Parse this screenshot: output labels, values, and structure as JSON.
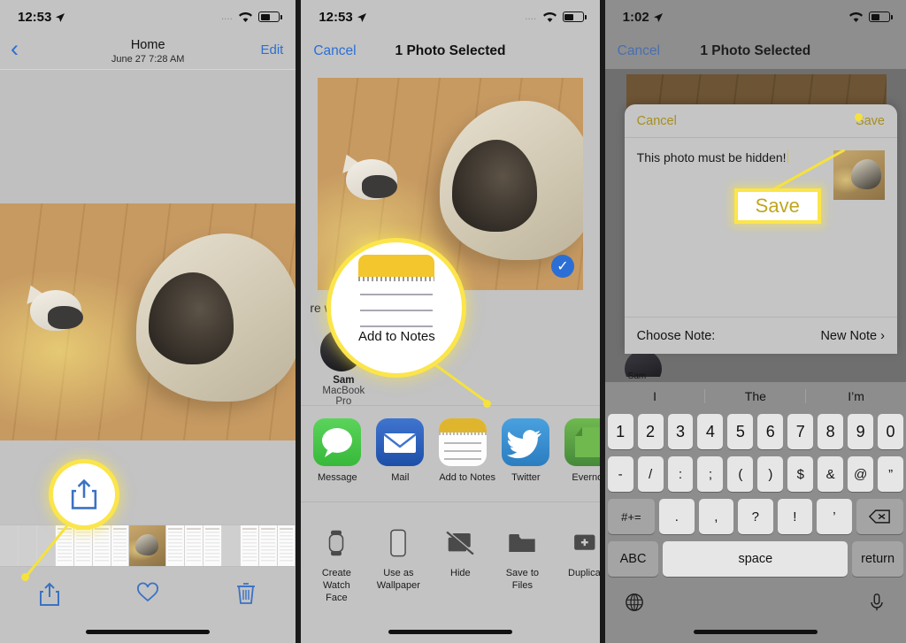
{
  "panel1": {
    "status": {
      "time": "12:53",
      "location_icon": "location-arrow-icon",
      "dots": "....",
      "wifi_icon": "wifi-icon",
      "battery_icon": "battery-icon"
    },
    "nav": {
      "back_icon": "chevron-left-icon",
      "title": "Home",
      "subtitle": "June 27  7:28 AM",
      "edit_label": "Edit"
    },
    "toolbar": {
      "share_icon": "share-icon",
      "favorite_icon": "heart-icon",
      "delete_icon": "trash-icon"
    },
    "callout": {
      "icon": "share-icon",
      "target": "share-button"
    }
  },
  "panel2": {
    "status": {
      "time": "12:53",
      "location_icon": "location-arrow-icon",
      "dots": "....",
      "wifi_icon": "wifi-icon",
      "battery_icon": "battery-icon"
    },
    "nav": {
      "cancel_label": "Cancel",
      "title": "1 Photo Selected"
    },
    "photo": {
      "selected_icon": "check-circle-icon"
    },
    "airdrop": {
      "label": "re with AirDrop",
      "person_name": "Sam",
      "person_device": "MacBook Pro"
    },
    "apps": [
      {
        "label": "Message",
        "icon": "message-icon"
      },
      {
        "label": "Mail",
        "icon": "mail-icon"
      },
      {
        "label": "Add to Notes",
        "icon": "notes-icon"
      },
      {
        "label": "Twitter",
        "icon": "twitter-icon"
      },
      {
        "label": "Evernot",
        "icon": "evernote-icon"
      }
    ],
    "actions": [
      {
        "label": "Create\nWatch Face",
        "line1": "Create",
        "line2": "Watch Face",
        "icon": "watch-icon"
      },
      {
        "label": "Use as Wallpaper",
        "line1": "Use as",
        "line2": "Wallpaper",
        "icon": "phone-icon"
      },
      {
        "label": "Hide",
        "line1": "Hide",
        "line2": "",
        "icon": "hide-slash-icon"
      },
      {
        "label": "Save to Files",
        "line1": "Save to Files",
        "line2": "",
        "icon": "folder-icon"
      },
      {
        "label": "Duplica",
        "line1": "Duplica",
        "line2": "",
        "icon": "duplicate-plus-icon"
      }
    ],
    "callout": {
      "label": "Add to Notes",
      "icon": "notes-icon",
      "target": "add-to-notes-app"
    }
  },
  "panel3": {
    "status": {
      "time": "1:02",
      "location_icon": "location-arrow-icon",
      "dots": "....",
      "wifi_icon": "wifi-icon",
      "battery_icon": "battery-icon"
    },
    "nav": {
      "cancel_label": "Cancel",
      "title": "1 Photo Selected"
    },
    "sheet": {
      "cancel_label": "Cancel",
      "save_label": "Save",
      "note_text": "This photo must be hidden!",
      "choose_note_label": "Choose Note:",
      "choose_note_value": "New Note",
      "chevron_icon": "chevron-right-icon"
    },
    "callout": {
      "label": "Save",
      "target": "save-button"
    },
    "background": {
      "person_name": "Sam"
    },
    "keyboard": {
      "predictions": [
        "I",
        "The",
        "I’m"
      ],
      "row_numbers": [
        "1",
        "2",
        "3",
        "4",
        "5",
        "6",
        "7",
        "8",
        "9",
        "0"
      ],
      "row_symbols": [
        "-",
        "/",
        ":",
        ";",
        "(",
        ")",
        "$",
        "&",
        "@",
        "”"
      ],
      "row_punct": [
        "#+=",
        ".",
        ",",
        "?",
        "!",
        "’",
        "delete-icon"
      ],
      "row_bottom": [
        "ABC",
        "space",
        "return"
      ],
      "globe_icon": "globe-icon",
      "mic_icon": "microphone-icon",
      "shift_label": "#+=",
      "abc_label": "ABC",
      "space_label": "space",
      "return_label": "return",
      "delete_icon": "backspace-icon"
    }
  },
  "colors": {
    "highlight": "#fbe54a",
    "ios_blue": "#2b6fd6",
    "notes_yellow": "#e0b52e",
    "panel_bg": "#c3c3c3"
  }
}
